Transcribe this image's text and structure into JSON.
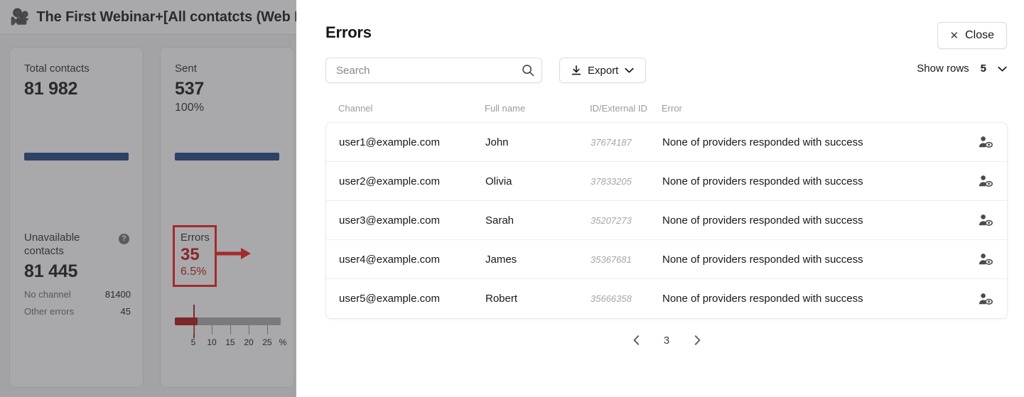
{
  "window": {
    "icon": "movie-camera-icon",
    "title": "The First Webinar+[All contatcts (Web P"
  },
  "stats": {
    "cards": [
      {
        "label": "Total contacts",
        "value": "81 982",
        "pct": "",
        "bar_color": "#1f4281"
      },
      {
        "label": "Sent",
        "value": "537",
        "pct": "100%",
        "bar_color": "#1f4281"
      }
    ],
    "unavailable": {
      "label": "Unavailable contacts",
      "value": "81 445",
      "help_icon": "?",
      "breakdown": [
        {
          "key": "No channel",
          "value": "81400"
        },
        {
          "key": "Other errors",
          "value": "45"
        }
      ]
    },
    "errors_card": {
      "label": "Errors",
      "value": "35",
      "pct": "6.5%",
      "highlight_color": "#f51b1b",
      "value_color": "#c21414",
      "annotation": "red-arrow-pointing-right"
    },
    "gauge": {
      "fill_pct": 6.5,
      "marker_pct": 5,
      "ticks": [
        5,
        10,
        15,
        20,
        25
      ],
      "tick_labels": [
        "5",
        "10",
        "15",
        "20",
        "25"
      ],
      "unit_label": "%",
      "fill_color": "#b01313",
      "track_color": "#a9a9ad"
    }
  },
  "modal": {
    "title": "Errors",
    "close_label": "Close",
    "close_icon": "close-x-icon",
    "search": {
      "placeholder": "Search",
      "value": "",
      "icon": "search-icon"
    },
    "export": {
      "label": "Export",
      "download_icon": "download-icon",
      "chevron_icon": "chevron-down-icon"
    },
    "show_rows": {
      "label": "Show rows",
      "value": "5",
      "chevron_icon": "chevron-down-icon"
    },
    "table": {
      "columns": [
        "Channel",
        "Full name",
        "ID/External ID",
        "Error"
      ],
      "rows": [
        {
          "channel": "user1@example.com",
          "full_name": "John",
          "id": "37674187",
          "error": "None of providers responded with success",
          "action_icon": "view-contact-icon"
        },
        {
          "channel": "user2@example.com",
          "full_name": "Olivia",
          "id": "37833205",
          "error": "None of providers responded with success",
          "action_icon": "view-contact-icon"
        },
        {
          "channel": "user3@example.com",
          "full_name": "Sarah",
          "id": "35207273",
          "error": "None of providers responded with success",
          "action_icon": "view-contact-icon"
        },
        {
          "channel": "user4@example.com",
          "full_name": "James",
          "id": "35367681",
          "error": "None of providers responded with success",
          "action_icon": "view-contact-icon"
        },
        {
          "channel": "user5@example.com",
          "full_name": "Robert",
          "id": "35666358",
          "error": "None of providers responded with success",
          "action_icon": "view-contact-icon"
        }
      ]
    },
    "pagination": {
      "prev_icon": "chevron-left-icon",
      "next_icon": "chevron-right-icon",
      "current_page": "3"
    }
  }
}
